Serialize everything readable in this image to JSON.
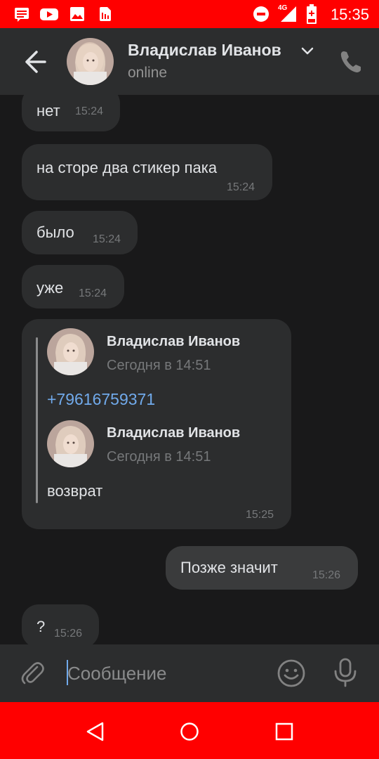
{
  "status_bar": {
    "time": "15:35",
    "network": "4G",
    "icons": [
      "message-notification-icon",
      "youtube-icon",
      "gallery-icon",
      "sim-icon",
      "do-not-disturb-icon",
      "signal-icon",
      "battery-icon"
    ],
    "color": "#ff0000"
  },
  "header": {
    "contact_name": "Владислав Иванов",
    "status": "online",
    "icons": [
      "back-arrow-icon",
      "chevron-down-icon",
      "phone-icon"
    ]
  },
  "messages": [
    {
      "text": "нет",
      "time": "15:24"
    },
    {
      "text": "на сторе два стикер пака",
      "time": "15:24"
    },
    {
      "text": "было",
      "time": "15:24"
    },
    {
      "text": "уже",
      "time": "15:24"
    },
    {
      "time": "15:25",
      "forwarded": [
        {
          "author": "Владислав Иванов",
          "date": "Сегодня в 14:51",
          "text": "+79616759371"
        },
        {
          "author": "Владислав Иванов",
          "date": "Сегодня в 14:51",
          "text": "возврат"
        }
      ]
    },
    {
      "text": "Позже значит",
      "time": "15:26",
      "outgoing": true
    },
    {
      "text": "?",
      "time": "15:26"
    }
  ],
  "composer": {
    "placeholder": "Сообщение",
    "icons": [
      "paperclip-icon",
      "emoji-icon",
      "microphone-icon"
    ]
  },
  "nav_bar": {
    "icons": [
      "back-triangle-icon",
      "home-circle-icon",
      "recents-square-icon"
    ]
  },
  "colors": {
    "background": "#19191a",
    "bubble": "#2c2d2e",
    "link": "#71aaeb",
    "system_bars": "#ff0000"
  }
}
